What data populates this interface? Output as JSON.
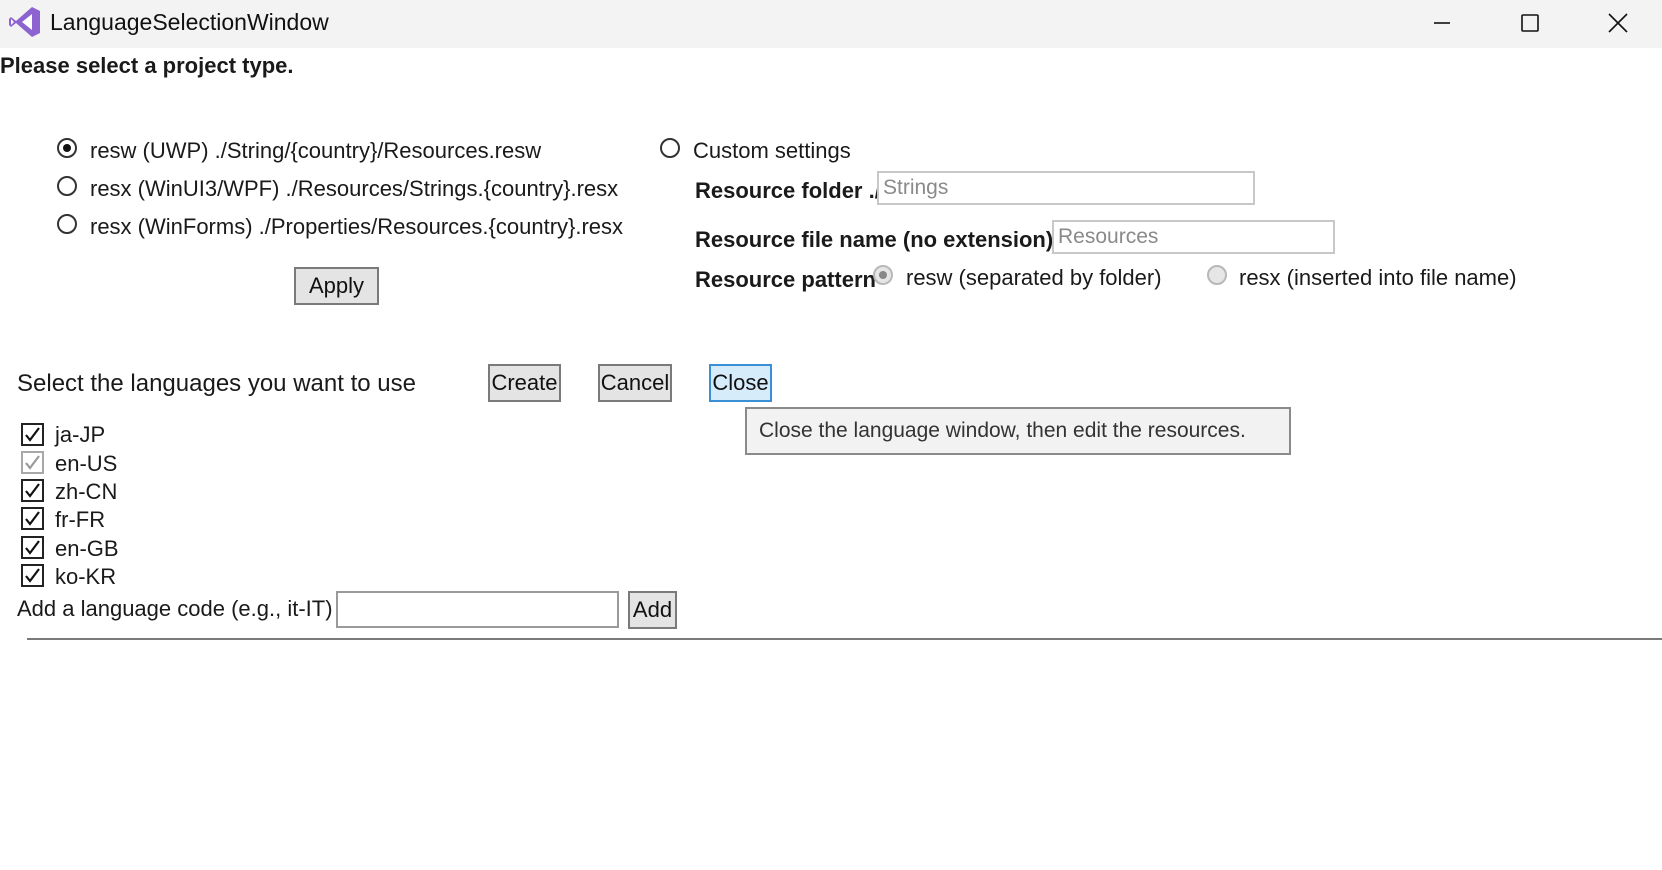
{
  "window": {
    "title": "LanguageSelectionWindow",
    "app_icon": "visual-studio-logo-icon",
    "controls": [
      "minimize-icon",
      "maximize-icon",
      "close-icon"
    ]
  },
  "project": {
    "heading": "Please select a project type.",
    "options": [
      {
        "label": "resw (UWP) ./String/{country}/Resources.resw",
        "checked": true
      },
      {
        "label": "resx (WinUI3/WPF) ./Resources/Strings.{country}.resx",
        "checked": false
      },
      {
        "label": "resx (WinForms) ./Properties/Resources.{country}.resx",
        "checked": false
      }
    ],
    "apply_label": "Apply"
  },
  "custom": {
    "label": "Custom settings",
    "folder_label": "Resource folder ./",
    "folder_placeholder": "Strings",
    "filename_label": "Resource file name (no extension)",
    "filename_placeholder": "Resources",
    "pattern_label": "Resource pattern",
    "pattern_options": [
      {
        "label": "resw (separated by folder)",
        "checked": true
      },
      {
        "label": "resx (inserted into file name)",
        "checked": false
      }
    ]
  },
  "languages": {
    "heading": "Select the languages you want to use",
    "create_label": "Create",
    "cancel_label": "Cancel",
    "close_label": "Close",
    "close_tooltip": "Close the language window, then edit the resources.",
    "items": [
      {
        "code": "ja-JP",
        "checked": true,
        "disabled": false
      },
      {
        "code": "en-US",
        "checked": true,
        "disabled": true
      },
      {
        "code": "zh-CN",
        "checked": true,
        "disabled": false
      },
      {
        "code": "fr-FR",
        "checked": true,
        "disabled": false
      },
      {
        "code": "en-GB",
        "checked": true,
        "disabled": false
      },
      {
        "code": "ko-KR",
        "checked": true,
        "disabled": false
      }
    ],
    "add_label": "Add a language code (e.g., it-IT)",
    "add_value": "",
    "add_button_label": "Add"
  }
}
